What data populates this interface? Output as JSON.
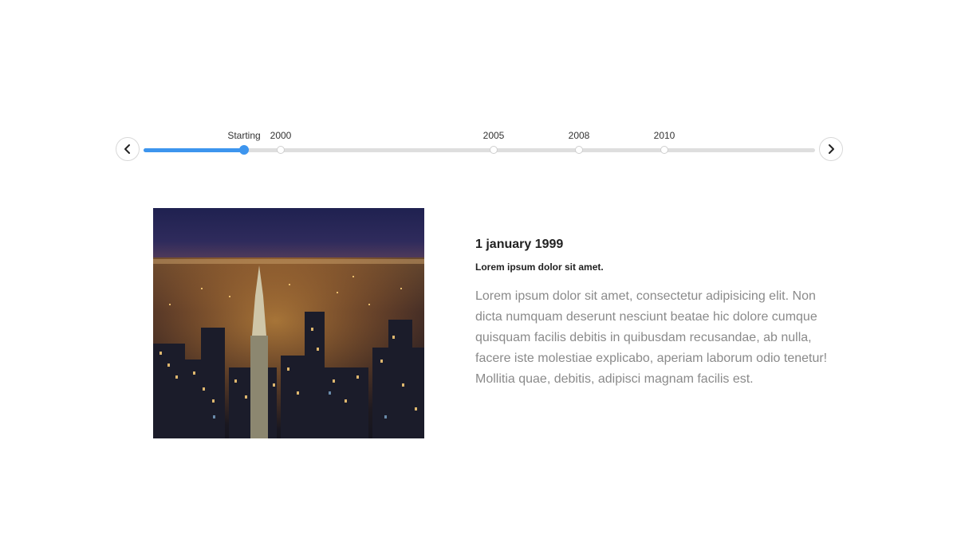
{
  "timeline": {
    "prev_icon": "chevron-left-icon",
    "next_icon": "chevron-right-icon",
    "accent_color": "#3d95ee",
    "active_index": 0,
    "events": [
      {
        "label": "Starting"
      },
      {
        "label": "2000"
      },
      {
        "label": "2005"
      },
      {
        "label": "2008"
      },
      {
        "label": "2010"
      }
    ]
  },
  "content": {
    "date": "1 january 1999",
    "subtitle": "Lorem ipsum dolor sit amet.",
    "body": "Lorem ipsum dolor sit amet, consectetur adipisicing elit. Non dicta numquam deserunt nesciunt beatae hic dolore cumque quisquam facilis debitis in quibusdam recusandae, ab nulla, facere iste molestiae explicabo, aperiam laborum odio tenetur! Mollitia quae, debitis, adipisci magnam facilis est."
  }
}
